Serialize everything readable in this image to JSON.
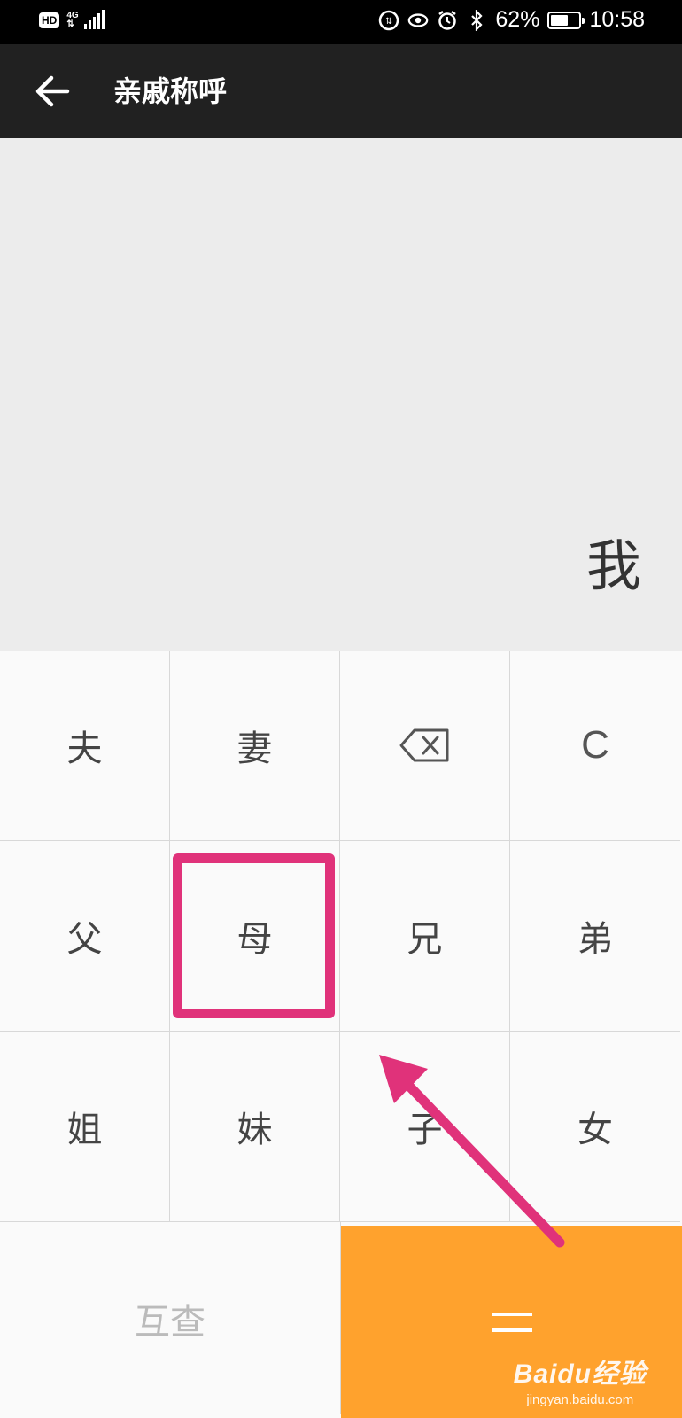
{
  "status_bar": {
    "hd": "HD",
    "network_gen": "4G",
    "network_sub": "⇅",
    "battery_percent": "62%",
    "battery_level": 0.62,
    "time": "10:58",
    "icons": [
      "data-saver-icon",
      "eye-comfort-icon",
      "alarm-icon",
      "bluetooth-icon",
      "battery-icon"
    ]
  },
  "header": {
    "title": "亲戚称呼",
    "back_icon": "arrow-left-icon"
  },
  "display": {
    "result": "我"
  },
  "keypad": {
    "row1": [
      "夫",
      "妻",
      "",
      "C"
    ],
    "row2": [
      "父",
      "母",
      "兄",
      "弟"
    ],
    "row3": [
      "姐",
      "妹",
      "子",
      "女"
    ],
    "backspace_icon": "backspace-icon",
    "lookup_label": "互查",
    "equals_icon": "equals-icon",
    "equals_color": "#ffa22d"
  },
  "annotation": {
    "highlight_color": "#e0327a",
    "highlighted_key": "母"
  },
  "watermark": {
    "logo": "Baidu经验",
    "url": "jingyan.baidu.com"
  }
}
